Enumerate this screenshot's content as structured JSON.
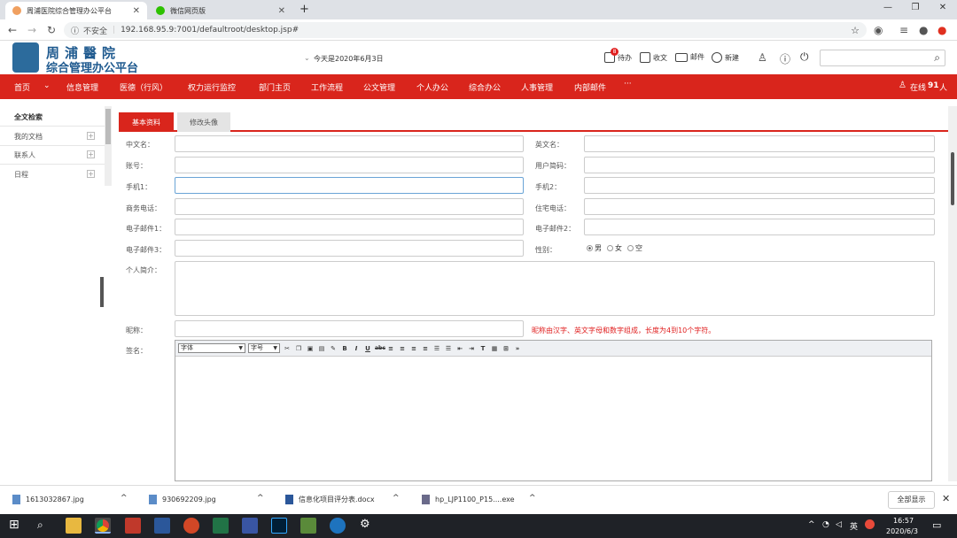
{
  "browser": {
    "tabs": [
      {
        "title": "周浦医院综合管理办公平台",
        "active": true
      },
      {
        "title": "微信网页版",
        "active": false
      }
    ],
    "new_tab": "+",
    "window_controls": [
      "—",
      "❐",
      "✕"
    ],
    "security": "不安全",
    "url": "192.168.95.9:7001/defaultroot/desktop.jsp#"
  },
  "header": {
    "logo_line1": "周浦醫院",
    "logo_line2": "综合管理办公平台",
    "date_text": "今天是2020年6月3日",
    "todo_label": "待办",
    "todo_badge": "8",
    "receive_label": "收文",
    "mail_label": "邮件",
    "new_label": "新建"
  },
  "menu": {
    "items": [
      "首页",
      "信息管理",
      "医德（行风）",
      "权力运行监控",
      "部门主页",
      "工作流程",
      "公文管理",
      "个人办公",
      "综合办公",
      "人事管理",
      "内部邮件",
      "···"
    ],
    "online_prefix": "在线",
    "online_count": "91",
    "online_suffix": "人"
  },
  "sidebar": {
    "title": "全文检索",
    "items": [
      {
        "label": "我的文档"
      },
      {
        "label": "联系人"
      },
      {
        "label": "日程"
      }
    ]
  },
  "form": {
    "tabs": [
      {
        "label": "基本资料",
        "active": true
      },
      {
        "label": "修改头像",
        "active": false
      }
    ],
    "labels": {
      "cn_name": "中文名：",
      "en_name": "英文名：",
      "account": "账号：",
      "user_short": "用户简码：",
      "mobile1": "手机1：",
      "mobile2": "手机2：",
      "biz_phone": "商务电话：",
      "home_phone": "住宅电话：",
      "email1": "电子邮件1：",
      "email2": "电子邮件2：",
      "email3": "电子邮件3：",
      "gender": "性别：",
      "intro": "个人简介：",
      "nickname": "昵称：",
      "signature": "签名："
    },
    "gender_options": [
      {
        "label": "男",
        "checked": true
      },
      {
        "label": "女",
        "checked": false
      },
      {
        "label": "空",
        "checked": false
      }
    ],
    "nickname_hint": "昵称由汉字、英文字母和数字组成，长度为4到10个字符。",
    "editor": {
      "font_select": "字体",
      "size_select": "字号"
    }
  },
  "downloads": {
    "items": [
      "1613032867.jpg",
      "930692209.jpg",
      "信息化项目评分表.docx",
      "hp_LJP1100_P15....exe"
    ],
    "show_all": "全部显示"
  },
  "taskbar": {
    "time": "16:57",
    "date": "2020/6/3",
    "ime": "英"
  }
}
